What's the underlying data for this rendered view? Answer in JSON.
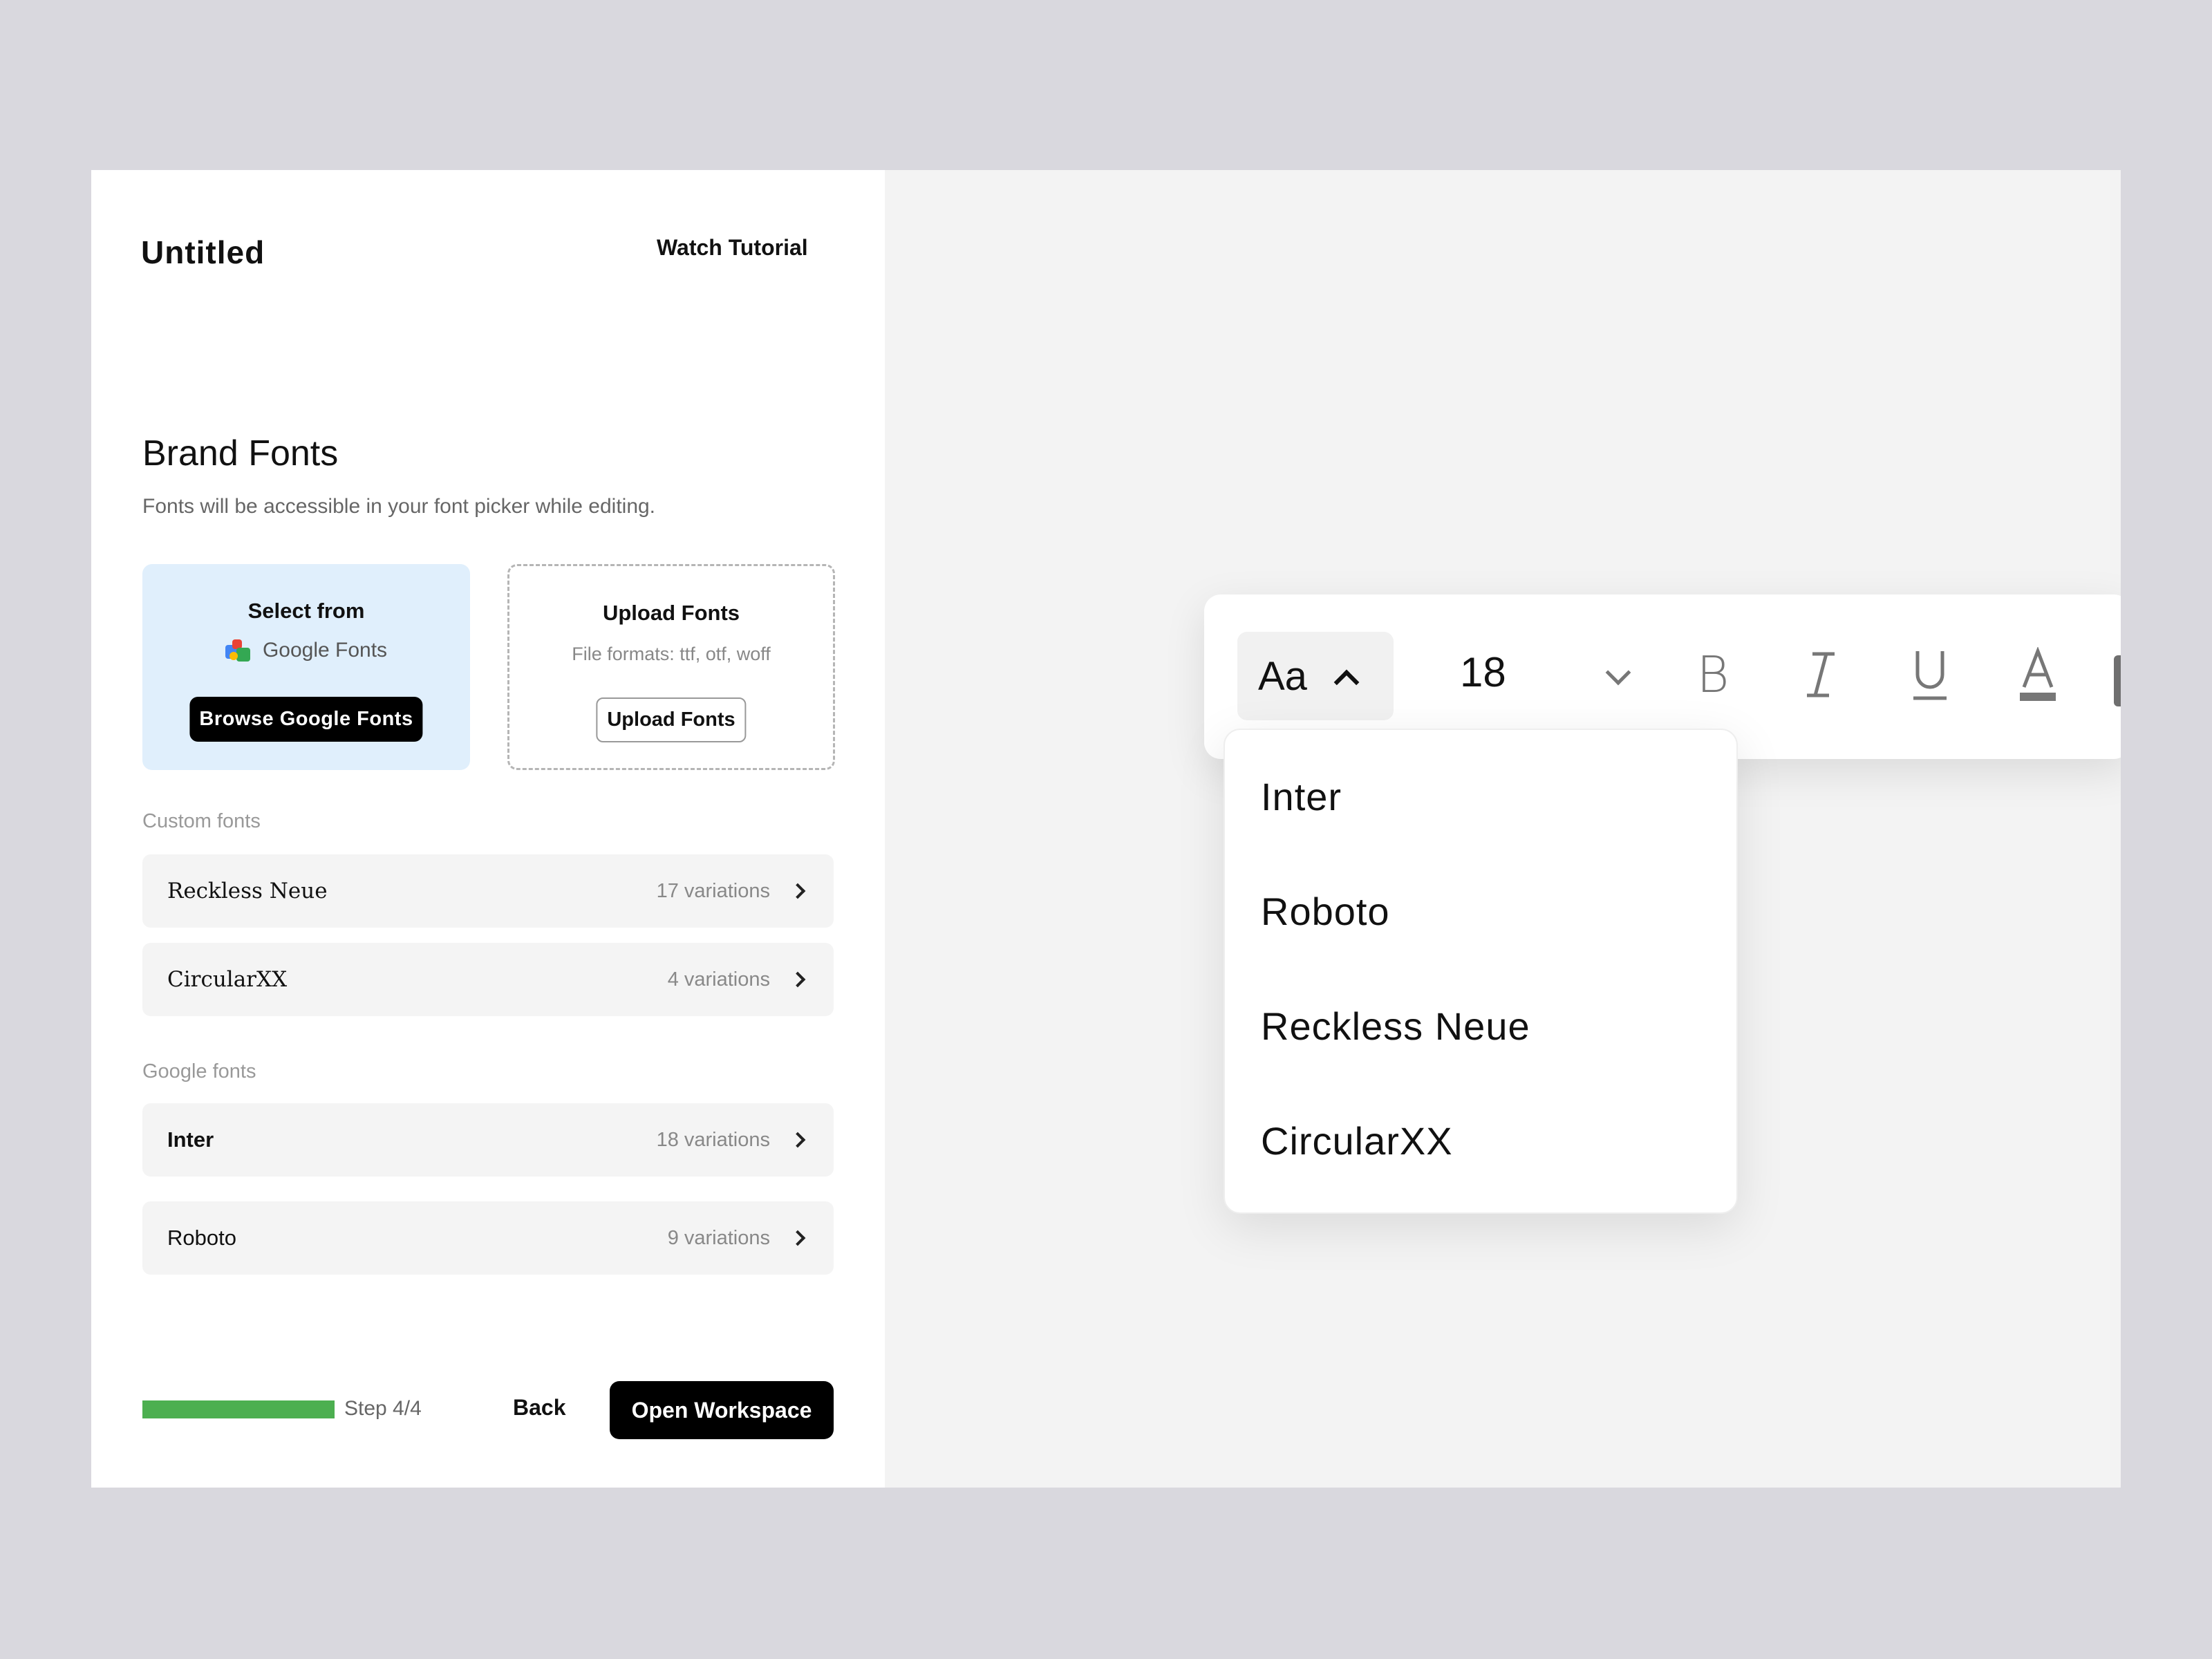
{
  "header": {
    "app_title": "Untitled",
    "tutorial_link": "Watch Tutorial"
  },
  "brand_fonts": {
    "title": "Brand Fonts",
    "subtitle": "Fonts will be accessible in your font picker while editing."
  },
  "google_card": {
    "title": "Select from",
    "provider": "Google Fonts",
    "button": "Browse Google Fonts",
    "background": "#e0effc"
  },
  "upload_card": {
    "title": "Upload Fonts",
    "formats": "File formats: ttf, otf, woff",
    "button": "Upload Fonts"
  },
  "custom_fonts": {
    "label": "Custom fonts",
    "items": [
      {
        "name": "Reckless Neue",
        "count": "17 variations"
      },
      {
        "name": "CircularXX",
        "count": "4 variations"
      }
    ]
  },
  "google_fonts": {
    "label": "Google fonts",
    "items": [
      {
        "name": "Inter",
        "count": "18 variations"
      },
      {
        "name": "Roboto",
        "count": "9 variations"
      }
    ]
  },
  "footer": {
    "progress_fraction": 1.0,
    "progress_color": "#4caf50",
    "step": "Step 4/4",
    "back": "Back",
    "open": "Open Workspace"
  },
  "toolbar": {
    "font_toggle": "Aa",
    "font_size": "18",
    "bold": "B",
    "italic": "I",
    "underline": "U",
    "text_color": "A",
    "highlight": "A"
  },
  "font_dropdown": {
    "options": [
      "Inter",
      "Roboto",
      "Reckless Neue",
      "CircularXX"
    ]
  }
}
